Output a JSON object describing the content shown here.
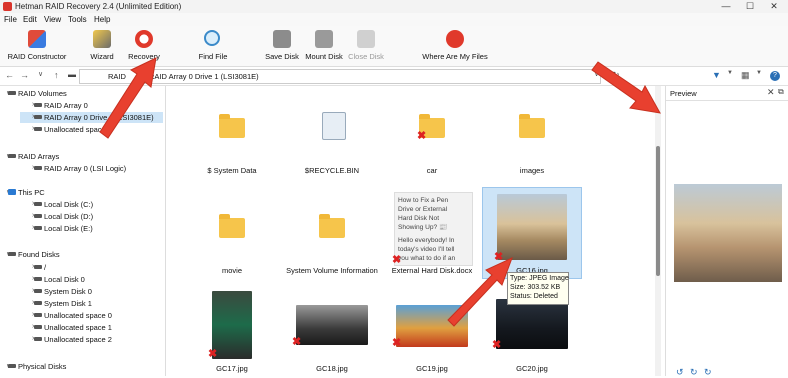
{
  "window": {
    "title": "Hetman RAID Recovery 2.4 (Unlimited Edition)"
  },
  "menu": [
    "File",
    "Edit",
    "View",
    "Tools",
    "Help"
  ],
  "toolbar": {
    "raid_constructor": "RAID Constructor",
    "wizard": "Wizard",
    "recovery": "Recovery",
    "find_file": "Find File",
    "save_disk": "Save Disk",
    "mount_disk": "Mount Disk",
    "close_disk": "Close Disk",
    "where_are_my_files": "Where Are My Files"
  },
  "path": {
    "seg1": "RAID",
    "seg2": "RAID Array 0 Drive 1 (LSI3081E)"
  },
  "tree": {
    "raid_volumes": "RAID Volumes",
    "rv1": "RAID Array 0",
    "rv2": "RAID Array 0 Drive 1 (LSI3081E)",
    "rv3": "Unallocated space 3",
    "raid_arrays": "RAID Arrays",
    "ra1": "RAID Array 0 (LSI Logic)",
    "this_pc": "This PC",
    "pc1": "Local Disk (C:)",
    "pc2": "Local Disk (D:)",
    "pc3": "Local Disk (E:)",
    "found_disks": "Found Disks",
    "fd1": "/",
    "fd2": "Local Disk 0",
    "fd3": "System Disk 0",
    "fd4": "System Disk 1",
    "fd5": "Unallocated space 0",
    "fd6": "Unallocated space 1",
    "fd7": "Unallocated space 2",
    "physical_disks": "Physical Disks"
  },
  "files": [
    {
      "name": "$ System Data"
    },
    {
      "name": "$RECYCLE.BIN"
    },
    {
      "name": "car"
    },
    {
      "name": "images"
    },
    {
      "name": "movie"
    },
    {
      "name": "System Volume Information"
    },
    {
      "name": "External Hard Disk.docx"
    },
    {
      "name": "GC16.jpg"
    },
    {
      "name": "GC17.jpg"
    },
    {
      "name": "GC18.jpg"
    },
    {
      "name": "GC19.jpg"
    },
    {
      "name": "GC20.jpg"
    }
  ],
  "doc_preview": [
    "How to Fix a Pen",
    "Drive or External",
    "Hard Disk Not",
    "Showing Up? 📰",
    "",
    "Hello everybody! In",
    "today's video I'll tell",
    "you what to do if an"
  ],
  "tooltip": {
    "type": "Type: JPEG Image",
    "size": "Size: 303.52 KB",
    "status": "Status: Deleted"
  },
  "preview": {
    "title": "Preview"
  },
  "colors": {
    "selection": "#cde4f7",
    "folder": "#f6c54b",
    "arrow": "#e8402f",
    "deleted": "#dd2222"
  }
}
